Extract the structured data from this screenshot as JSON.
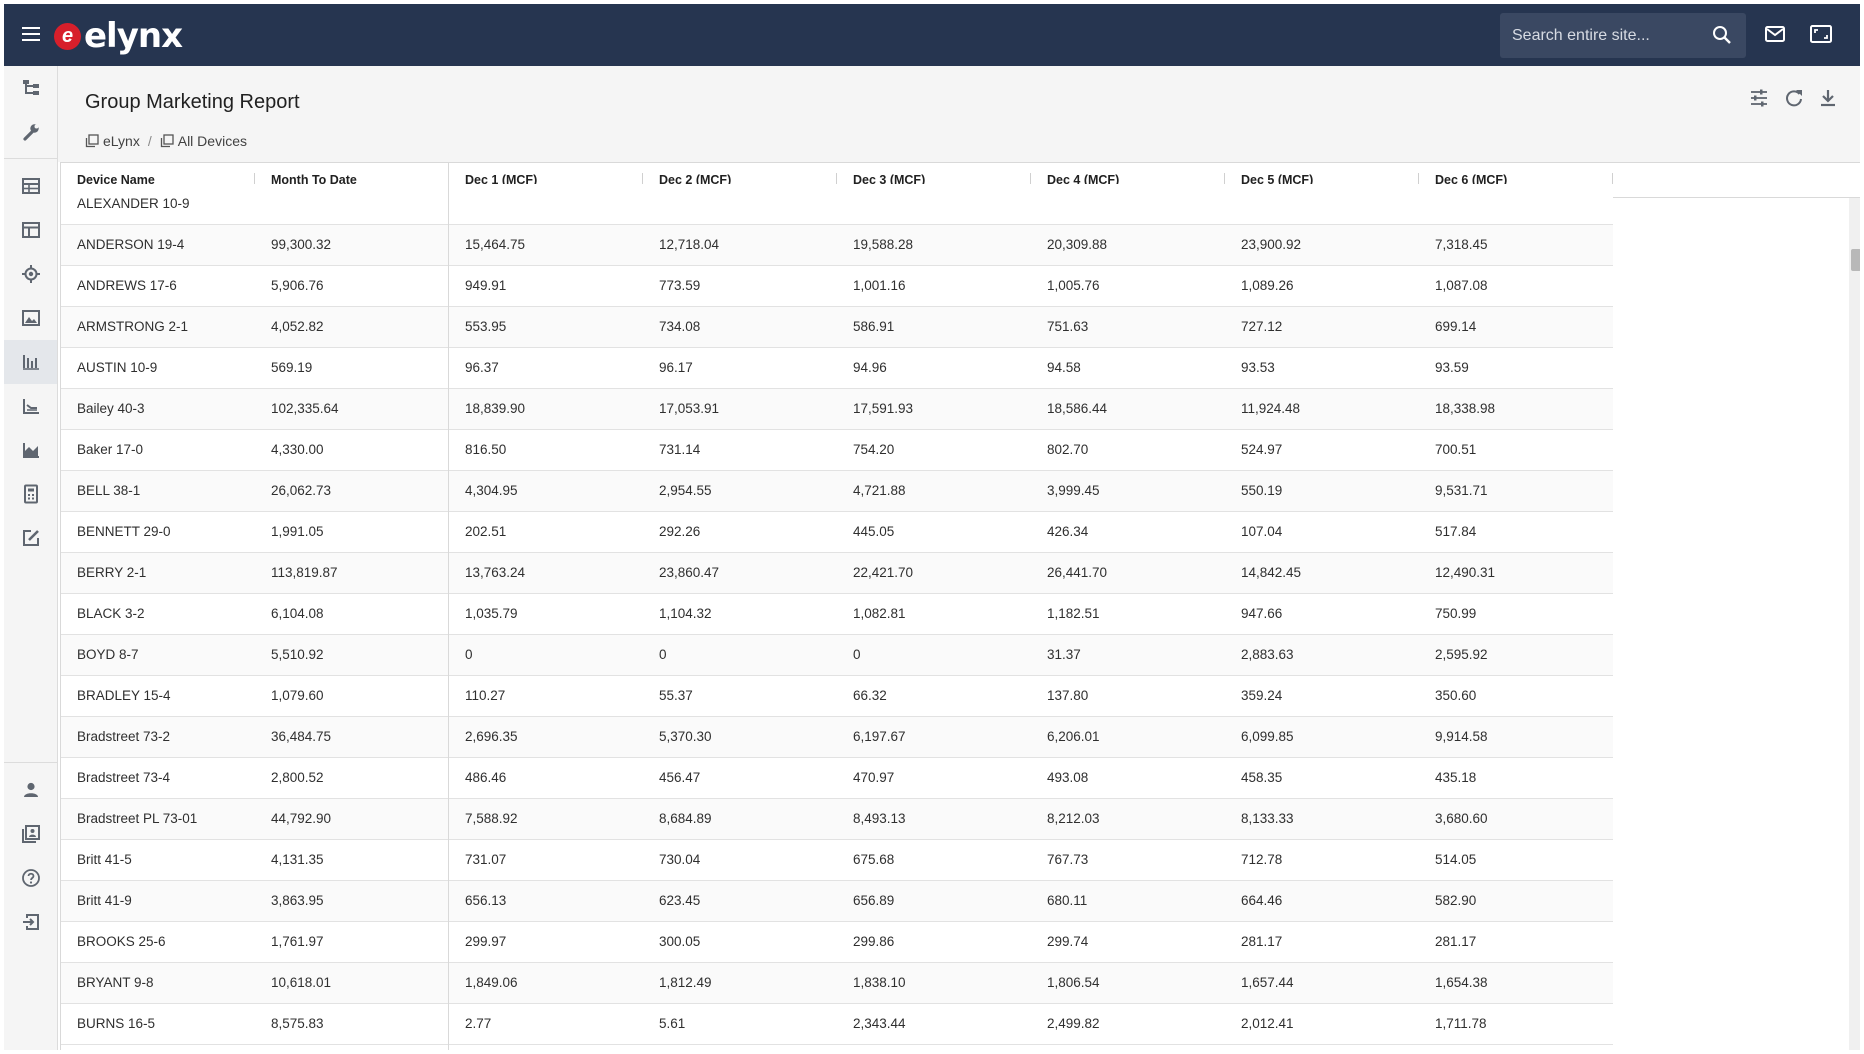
{
  "app": {
    "logo_mark": "e",
    "logo_text": "elynx"
  },
  "search": {
    "placeholder": "Search entire site..."
  },
  "page": {
    "title": "Group Marketing Report"
  },
  "breadcrumb": [
    {
      "label": "eLynx"
    },
    {
      "label": "All Devices"
    }
  ],
  "table": {
    "columns": [
      "Device Name",
      "Month To Date",
      "Dec 1 (MCF)",
      "Dec 2 (MCF)",
      "Dec 3 (MCF)",
      "Dec 4 (MCF)",
      "Dec 5 (MCF)",
      "Dec 6 (MCF)"
    ],
    "rows": [
      [
        "ALEXANDER 10-9",
        "",
        "",
        "",
        "",
        "",
        "",
        ""
      ],
      [
        "ANDERSON 19-4",
        "99,300.32",
        "15,464.75",
        "12,718.04",
        "19,588.28",
        "20,309.88",
        "23,900.92",
        "7,318.45"
      ],
      [
        "ANDREWS 17-6",
        "5,906.76",
        "949.91",
        "773.59",
        "1,001.16",
        "1,005.76",
        "1,089.26",
        "1,087.08"
      ],
      [
        "ARMSTRONG 2-1",
        "4,052.82",
        "553.95",
        "734.08",
        "586.91",
        "751.63",
        "727.12",
        "699.14"
      ],
      [
        "AUSTIN 10-9",
        "569.19",
        "96.37",
        "96.17",
        "94.96",
        "94.58",
        "93.53",
        "93.59"
      ],
      [
        "Bailey 40-3",
        "102,335.64",
        "18,839.90",
        "17,053.91",
        "17,591.93",
        "18,586.44",
        "11,924.48",
        "18,338.98"
      ],
      [
        "Baker 17-0",
        "4,330.00",
        "816.50",
        "731.14",
        "754.20",
        "802.70",
        "524.97",
        "700.51"
      ],
      [
        "BELL 38-1",
        "26,062.73",
        "4,304.95",
        "2,954.55",
        "4,721.88",
        "3,999.45",
        "550.19",
        "9,531.71"
      ],
      [
        "BENNETT 29-0",
        "1,991.05",
        "202.51",
        "292.26",
        "445.05",
        "426.34",
        "107.04",
        "517.84"
      ],
      [
        "BERRY 2-1",
        "113,819.87",
        "13,763.24",
        "23,860.47",
        "22,421.70",
        "26,441.70",
        "14,842.45",
        "12,490.31"
      ],
      [
        "BLACK 3-2",
        "6,104.08",
        "1,035.79",
        "1,104.32",
        "1,082.81",
        "1,182.51",
        "947.66",
        "750.99"
      ],
      [
        "BOYD 8-7",
        "5,510.92",
        "0",
        "0",
        "0",
        "31.37",
        "2,883.63",
        "2,595.92"
      ],
      [
        "BRADLEY 15-4",
        "1,079.60",
        "110.27",
        "55.37",
        "66.32",
        "137.80",
        "359.24",
        "350.60"
      ],
      [
        "Bradstreet 73-2",
        "36,484.75",
        "2,696.35",
        "5,370.30",
        "6,197.67",
        "6,206.01",
        "6,099.85",
        "9,914.58"
      ],
      [
        "Bradstreet 73-4",
        "2,800.52",
        "486.46",
        "456.47",
        "470.97",
        "493.08",
        "458.35",
        "435.18"
      ],
      [
        "Bradstreet PL 73-01",
        "44,792.90",
        "7,588.92",
        "8,684.89",
        "8,493.13",
        "8,212.03",
        "8,133.33",
        "3,680.60"
      ],
      [
        "Britt 41-5",
        "4,131.35",
        "731.07",
        "730.04",
        "675.68",
        "767.73",
        "712.78",
        "514.05"
      ],
      [
        "Britt 41-9",
        "3,863.95",
        "656.13",
        "623.45",
        "656.89",
        "680.11",
        "664.46",
        "582.90"
      ],
      [
        "BROOKS 25-6",
        "1,761.97",
        "299.97",
        "300.05",
        "299.86",
        "299.74",
        "281.17",
        "281.17"
      ],
      [
        "BRYANT 9-8",
        "10,618.01",
        "1,849.06",
        "1,812.49",
        "1,838.10",
        "1,806.54",
        "1,657.44",
        "1,654.38"
      ],
      [
        "BURNS 16-5",
        "8,575.83",
        "2.77",
        "5.61",
        "2,343.44",
        "2,499.82",
        "2,012.41",
        "1,711.78"
      ]
    ]
  },
  "colors": {
    "topbar": "#263550",
    "brand_red": "#d71f2b",
    "sidenav": "#f5f5f5",
    "header": "#f5f5f5"
  },
  "icons": {
    "top": [
      "menu-icon",
      "search-icon",
      "mail-icon",
      "fullscreen-icon"
    ],
    "sidenav": [
      "hierarchy-icon",
      "wrench-icon",
      "table-icon",
      "layout-icon",
      "target-icon",
      "image-icon",
      "report-icon",
      "line-chart-icon",
      "area-chart-icon",
      "calculator-icon",
      "edit-icon",
      "user-icon",
      "contacts-icon",
      "help-icon",
      "logout-icon"
    ],
    "header": [
      "settings-sliders-icon",
      "refresh-icon",
      "download-icon"
    ]
  }
}
